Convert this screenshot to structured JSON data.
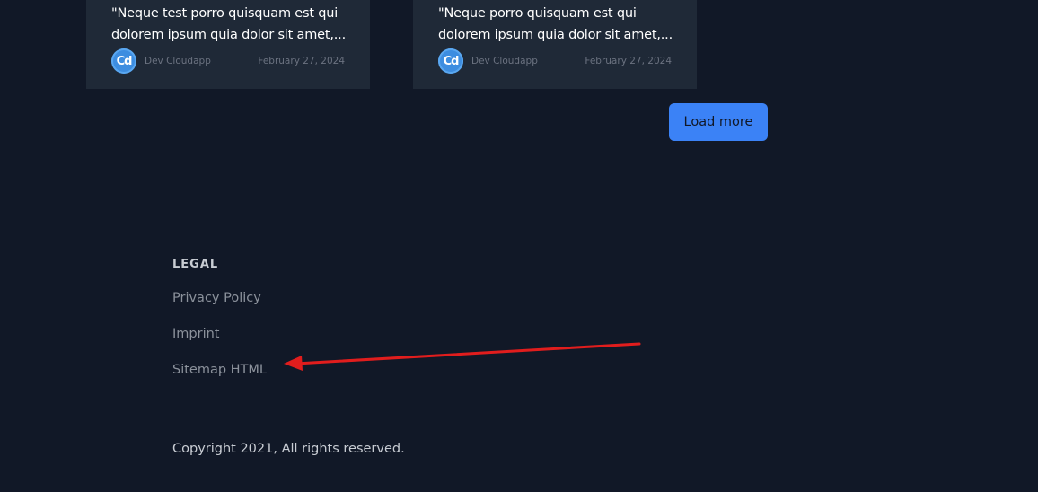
{
  "posts": [
    {
      "title_line1": "\"Neque test porro quisquam est qui",
      "title_line2": "dolorem ipsum quia dolor sit amet,...",
      "avatar_text": "Cd",
      "author": "Dev Cloudapp",
      "date": "February 27, 2024"
    },
    {
      "title_line1": "\"Neque porro quisquam est qui",
      "title_line2": "dolorem ipsum quia dolor sit amet,...",
      "avatar_text": "Cd",
      "author": "Dev Cloudapp",
      "date": "February 27, 2024"
    }
  ],
  "load_more_label": "Load more",
  "footer": {
    "legal_heading": "LEGAL",
    "links": [
      "Privacy Policy",
      "Imprint",
      "Sitemap HTML"
    ],
    "copyright": "Copyright 2021, All rights reserved."
  },
  "colors": {
    "background": "#111827",
    "card": "#1f2937",
    "accent": "#3b82f6",
    "annotation_arrow": "#e11d1d"
  },
  "annotation": {
    "icon": "red-arrow-pointing-left",
    "target": "Sitemap HTML"
  }
}
